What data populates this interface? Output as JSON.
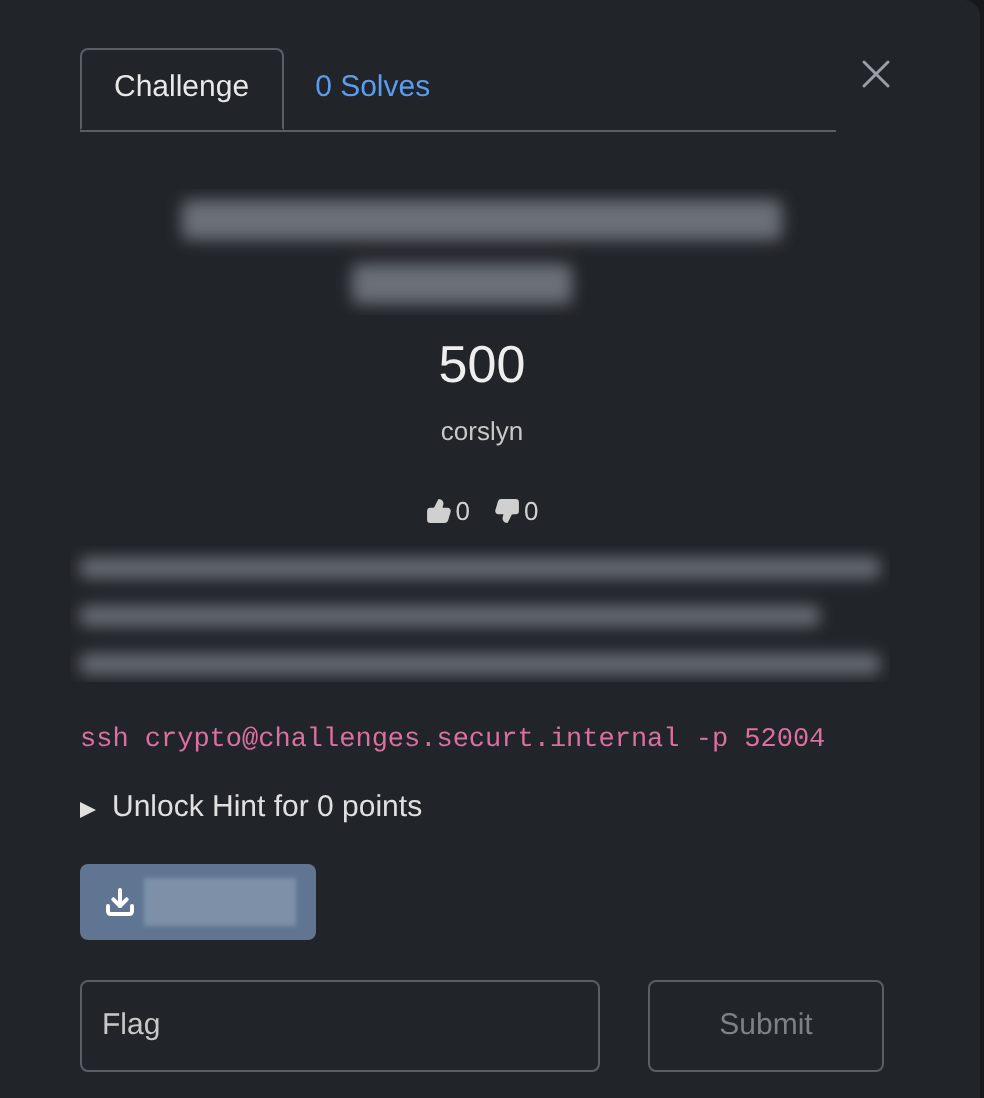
{
  "tabs": [
    {
      "label": "Challenge",
      "selected": true
    },
    {
      "label": "0 Solves",
      "selected": false
    }
  ],
  "value": "500",
  "author": "corslyn",
  "votes": {
    "up": "0",
    "down": "0"
  },
  "command": "ssh crypto@challenges.securt.internal -p 52004",
  "hint": {
    "label": "Unlock Hint for 0 points",
    "expanded": false
  },
  "flag": {
    "placeholder": "Flag"
  },
  "submit": {
    "label": "Submit",
    "disabled": true
  }
}
